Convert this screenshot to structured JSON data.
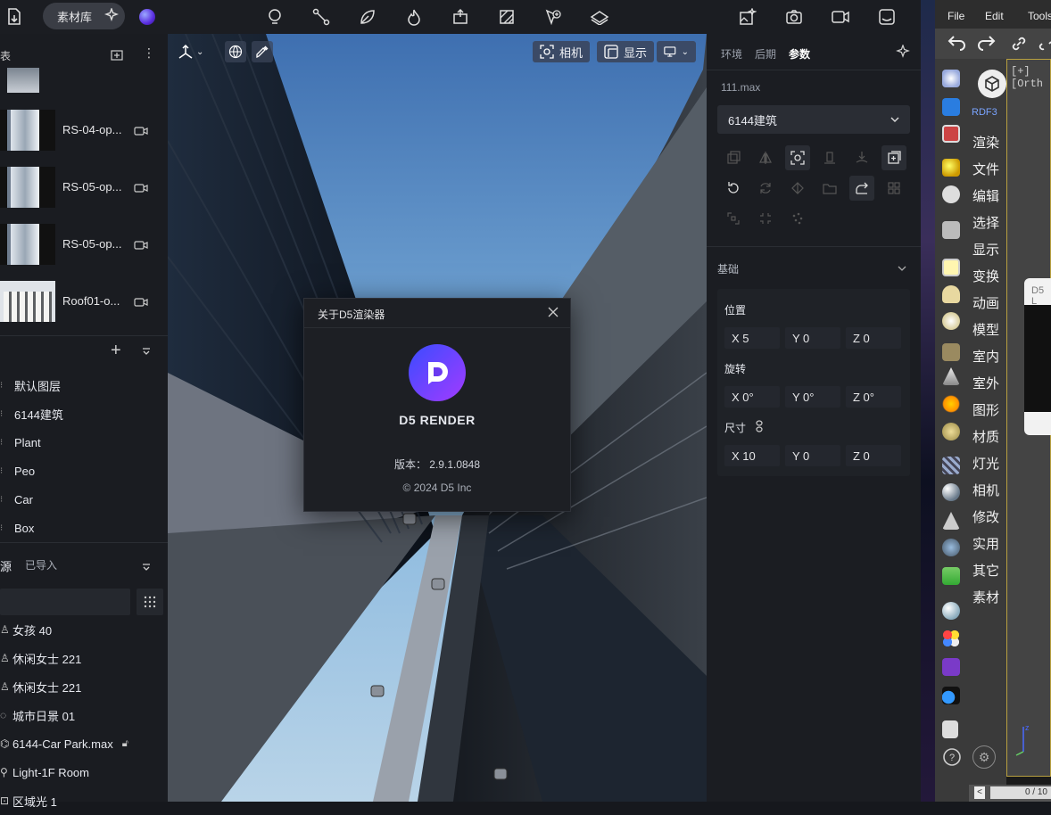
{
  "topbar": {
    "library_button": "素材库",
    "icons": [
      "import-icon",
      "ai-sparkle-icon",
      "d5-orb-icon",
      "light-icon",
      "path-icon",
      "leaf-icon",
      "fire-icon",
      "transform-icon",
      "material-icon",
      "add-poi-icon",
      "terrain-icon",
      "image-ai-icon",
      "camera-icon",
      "video-icon",
      "panorama-icon"
    ]
  },
  "left_panel": {
    "top_header": "表",
    "assets": [
      {
        "name": "RS-04-op..."
      },
      {
        "name": "RS-05-op..."
      },
      {
        "name": "RS-05-op..."
      },
      {
        "name": "Roof01-o..."
      }
    ],
    "layers": [
      "默认图层",
      "6144建筑",
      "Plant",
      "Peo",
      "Car",
      "Box"
    ],
    "resource_header": "源",
    "resource_tab": "已导入",
    "resources": [
      {
        "label": "女孩 40"
      },
      {
        "label": "休闲女士 221"
      },
      {
        "label": "休闲女士 221"
      },
      {
        "label": "城市日景 01"
      },
      {
        "label": "6144-Car Park.max"
      },
      {
        "label": "Light-1F Room"
      },
      {
        "label": "区域光 1"
      }
    ]
  },
  "viewport": {
    "camera_button": "相机",
    "display_button": "显示"
  },
  "right_panel": {
    "tabs": [
      "环境",
      "后期",
      "参数"
    ],
    "active_tab": "参数",
    "file_name": "111.max",
    "layer_select": "6144建筑",
    "section_basic": "基础",
    "position_label": "位置",
    "rotation_label": "旋转",
    "size_label": "尺寸",
    "position": {
      "x": "X 5",
      "y": "Y 0",
      "z": "Z 0"
    },
    "rotation": {
      "x": "X 0°",
      "y": "Y 0°",
      "z": "Z 0°"
    },
    "size": {
      "x": "X 10",
      "y": "Y 0",
      "z": "Z 0"
    }
  },
  "dialog": {
    "title": "关于D5渲染器",
    "product": "D5 RENDER",
    "version": "版本：  2.9.1.0848",
    "copyright": "© 2024 D5 Inc"
  },
  "max": {
    "menu": [
      "File",
      "Edit",
      "Tools"
    ],
    "viewport_label": "[+][Orth",
    "rdf_label": "RDF3",
    "commands": [
      "渲染",
      "文件",
      "编辑",
      "选择",
      "显示",
      "变换",
      "动画",
      "模型",
      "室内",
      "室外",
      "图形",
      "材质",
      "灯光",
      "相机",
      "修改",
      "实用",
      "其它",
      "素材"
    ],
    "frame_counter": "0 / 10",
    "popup_label": "D5 L",
    "axis_label": "z"
  }
}
